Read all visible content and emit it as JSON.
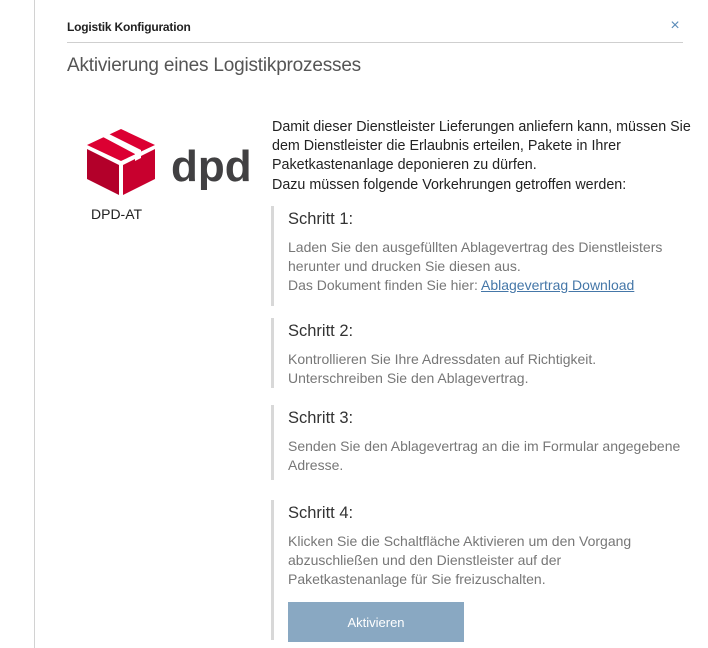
{
  "dialog": {
    "title": "Logistik Konfiguration",
    "close_label": "×",
    "heading": "Aktivierung eines Logistikprozesses"
  },
  "provider": {
    "name": "DPD-AT",
    "logo_text": "dpd",
    "brand_color": "#dc0032"
  },
  "intro": {
    "paragraph1": "Damit dieser Dienstleister Lieferungen anliefern kann, müssen Sie dem Dienstleister die Erlaubnis erteilen, Pakete in Ihrer Paketkastenanlage deponieren zu dürfen.",
    "paragraph2": "Dazu müssen folgende Vorkehrungen getroffen werden:"
  },
  "steps": [
    {
      "title": "Schritt 1:",
      "lines": [
        "Laden Sie den ausgefüllten Ablagevertrag des Dienstleisters herunter und drucken Sie diesen aus."
      ],
      "link_prefix": "Das Dokument finden Sie hier: ",
      "link_text": "Ablagevertrag Download"
    },
    {
      "title": "Schritt 2:",
      "lines": [
        "Kontrollieren Sie Ihre Adressdaten auf Richtigkeit.",
        "Unterschreiben Sie den Ablagevertrag."
      ]
    },
    {
      "title": "Schritt 3:",
      "lines": [
        "Senden Sie den Ablagevertrag an die im Formular angegebene Adresse."
      ]
    },
    {
      "title": "Schritt 4:",
      "lines": [
        "Klicken Sie die Schaltfläche Aktivieren um den Vorgang abzuschließen und den Dienstleister auf der Paketkastenanlage für Sie freizuschalten."
      ]
    }
  ],
  "actions": {
    "activate_label": "Aktivieren"
  },
  "colors": {
    "accent": "#4577a8",
    "button": "#89a8c2",
    "close": "#5a8bb8"
  }
}
